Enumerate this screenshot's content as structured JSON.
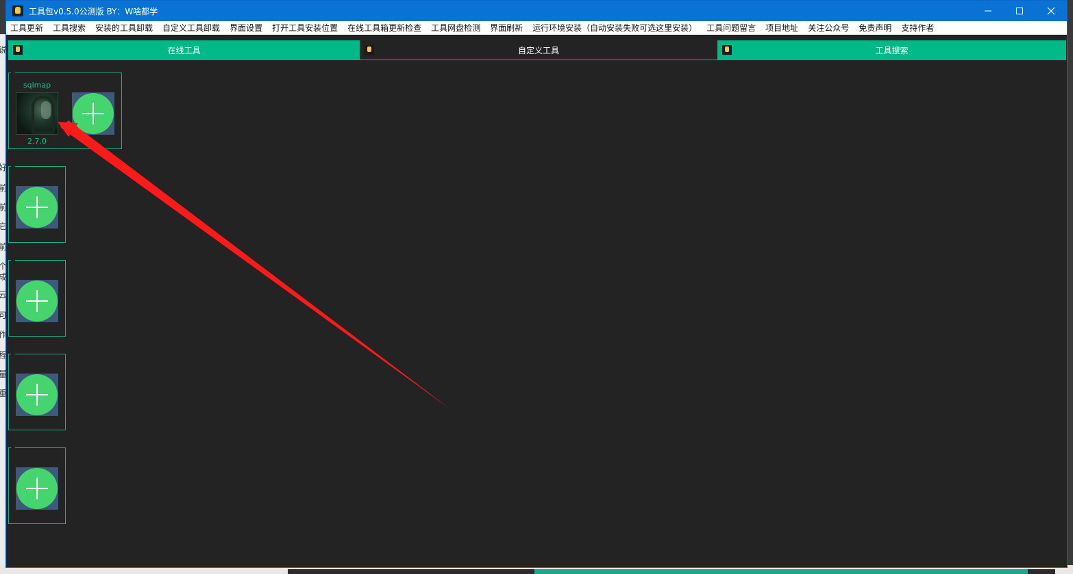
{
  "window": {
    "title": "工具包v0.5.0公测版  BY：W啥都学",
    "controls": [
      "minimize-icon",
      "maximize-icon",
      "close-icon"
    ]
  },
  "menu": [
    "工具更新",
    "工具搜索",
    "安装的工具卸载",
    "自定义工具卸载",
    "界面设置",
    "打开工具安装位置",
    "在线工具箱更新检查",
    "工具网盘检测",
    "界面刷新",
    "运行环境安装（自动安装失败可选这里安装）",
    "工具问题留言",
    "项目地址",
    "关注公众号",
    "免责声明",
    "支持作者"
  ],
  "tabs": [
    {
      "label": "在线工具",
      "active": false
    },
    {
      "label": "自定义工具",
      "active": true
    },
    {
      "label": "工具搜索",
      "active": false
    }
  ],
  "tool": {
    "name": "sqlmap",
    "version": "2.7.0"
  },
  "background_glyphs": [
    "说",
    "好",
    "前",
    "前",
    "它",
    "前",
    "个",
    "成",
    "云",
    "可",
    "作",
    "程",
    "量",
    "重"
  ],
  "colors": {
    "titlebar": "#0a72d2",
    "tab_green": "#00b888",
    "panel_bg": "#232323",
    "group_border": "#1fb08a",
    "add_circle": "#46d46e",
    "arrow": "#ff1a1a"
  }
}
